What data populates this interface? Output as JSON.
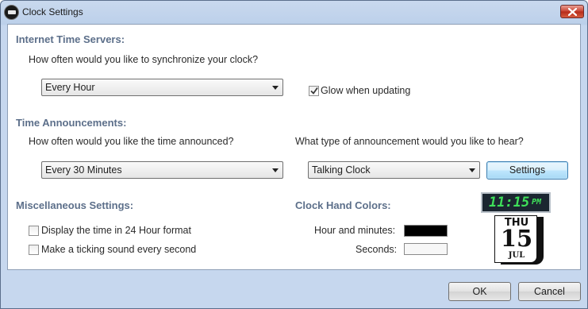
{
  "window": {
    "title": "Clock Settings",
    "close_icon": "close-icon"
  },
  "internet": {
    "heading": "Internet Time Servers:",
    "question": "How often would you like to synchronize your clock?",
    "sync_value": "Every Hour",
    "glow_label": "Glow when updating",
    "glow_checked": true
  },
  "announce": {
    "heading": "Time Announcements:",
    "frequency_question": "How often would you like the time announced?",
    "frequency_value": "Every 30 Minutes",
    "type_question": "What type of announcement would you like to hear?",
    "type_value": "Talking Clock",
    "settings_label": "Settings"
  },
  "misc": {
    "heading": "Miscellaneous Settings:",
    "format24_label": "Display the time in 24 Hour format",
    "format24_checked": false,
    "ticking_label": "Make a ticking sound every second",
    "ticking_checked": false
  },
  "hands": {
    "heading": "Clock Hand Colors:",
    "hours_label": "Hour and minutes:",
    "hours_color": "#000000",
    "seconds_label": "Seconds:",
    "seconds_color": "#f7f7f7"
  },
  "preview": {
    "time": "11:15",
    "ampm": "PM",
    "day": "THU",
    "date": "15",
    "month": "JUL",
    "digit_color": "#3fe05a"
  },
  "footer": {
    "ok_label": "OK",
    "cancel_label": "Cancel"
  }
}
